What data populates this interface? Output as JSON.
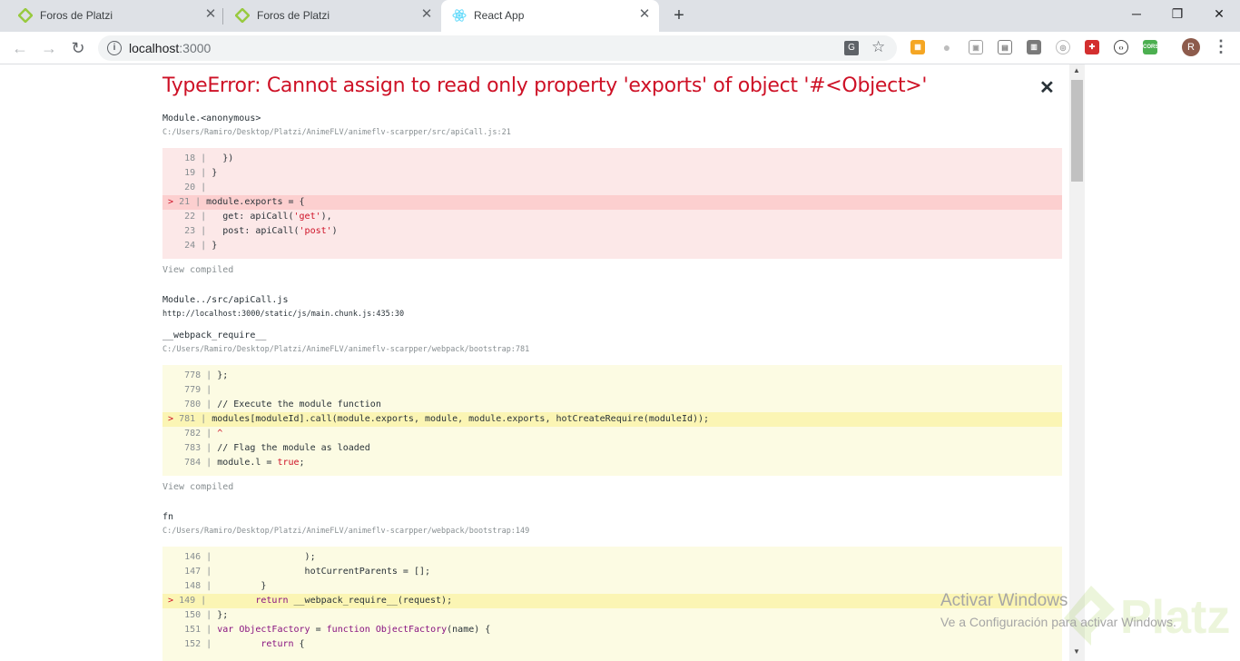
{
  "tabs": [
    {
      "title": "Foros de Platzi",
      "icon": "platzi-favicon-icon",
      "active": false
    },
    {
      "title": "Foros de Platzi",
      "icon": "platzi-favicon-icon",
      "active": false
    },
    {
      "title": "React App",
      "icon": "react-favicon-icon",
      "active": true
    }
  ],
  "tab_close_glyph": "✕",
  "new_tab_glyph": "+",
  "window_controls": {
    "minimize": "─",
    "restore": "❐",
    "close": "✕"
  },
  "address_bar": {
    "host": "localhost",
    "port": ":3000"
  },
  "profile_initial": "R",
  "error": {
    "title": "TypeError: Cannot assign to read only property 'exports' of object '#<Object>'",
    "close_glyph": "✕",
    "view_compiled_label": "View compiled",
    "frames": [
      {
        "name": "Module.<anonymous>",
        "path": "C:/Users/Ramiro/Desktop/Platzi/AnimeFLV/animeflv-scarpper/src/apiCall.js:21",
        "lines": [
          {
            "n": "18",
            "code": "  })"
          },
          {
            "n": "19",
            "code": "}"
          },
          {
            "n": "20",
            "code": ""
          },
          {
            "n": "21",
            "code": "module.exports = {",
            "highlight": true
          },
          {
            "n": "22",
            "code": "  get: apiCall('get'),"
          },
          {
            "n": "23",
            "code": "  post: apiCall('post')"
          },
          {
            "n": "24",
            "code": "}"
          }
        ]
      },
      {
        "name": "Module../src/apiCall.js",
        "path": "http://localhost:3000/static/js/main.chunk.js:435:30"
      },
      {
        "name": "__webpack_require__",
        "path": "C:/Users/Ramiro/Desktop/Platzi/AnimeFLV/animeflv-scarpper/webpack/bootstrap:781",
        "lines": [
          {
            "n": "778",
            "code": "};"
          },
          {
            "n": "779",
            "code": ""
          },
          {
            "n": "780",
            "code": "// Execute the module function"
          },
          {
            "n": "781",
            "code": "modules[moduleId].call(module.exports, module, module.exports, hotCreateRequire(moduleId));",
            "highlight": true
          },
          {
            "n": "782",
            "code": "^"
          },
          {
            "n": "783",
            "code": "// Flag the module as loaded"
          },
          {
            "n": "784",
            "code": "module.l = true;"
          }
        ]
      },
      {
        "name": "fn",
        "path": "C:/Users/Ramiro/Desktop/Platzi/AnimeFLV/animeflv-scarpper/webpack/bootstrap:149",
        "lines": [
          {
            "n": "146",
            "code": "                );"
          },
          {
            "n": "147",
            "code": "                hotCurrentParents = [];"
          },
          {
            "n": "148",
            "code": "        }"
          },
          {
            "n": "149",
            "code": "        return __webpack_require__(request);",
            "highlight": true
          },
          {
            "n": "150",
            "code": "};"
          },
          {
            "n": "151",
            "code": "var ObjectFactory = function ObjectFactory(name) {"
          },
          {
            "n": "152",
            "code": "        return {"
          }
        ]
      }
    ]
  },
  "watermark": {
    "activate_title": "Activar Windows",
    "activate_sub": "Ve a Configuración para activar Windows.",
    "platzi": "Platzi"
  },
  "colors": {
    "error_red": "#ce1126",
    "red_block_bg": "#fce8e8",
    "yellow_block_bg": "#fcfbe3"
  }
}
